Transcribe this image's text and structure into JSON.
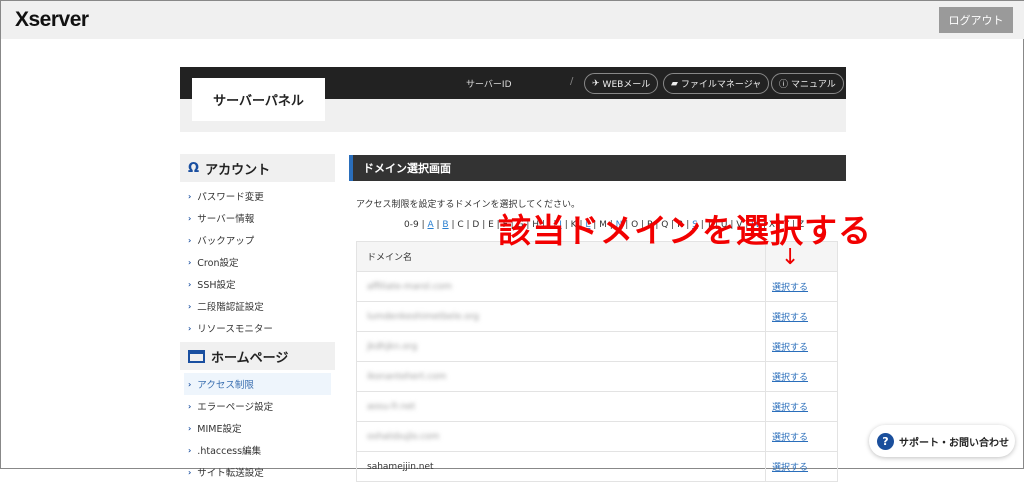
{
  "header": {
    "logo": "Xserver",
    "logout": "ログアウト"
  },
  "panel": {
    "title": "サーバーパネル",
    "server_id_label": "サーバーID",
    "separator": "/",
    "webmail": "WEBメール",
    "file_manager": "ファイルマネージャ",
    "manual": "マニュアル"
  },
  "sidebar": {
    "sections": [
      {
        "title": "アカウント",
        "icon": "user-icon",
        "items": [
          "パスワード変更",
          "サーバー情報",
          "バックアップ",
          "Cron設定",
          "SSH設定",
          "二段階認証設定",
          "リソースモニター"
        ]
      },
      {
        "title": "ホームページ",
        "icon": "window-icon",
        "items": [
          "アクセス制限",
          "エラーページ設定",
          "MIME設定",
          ".htaccess編集",
          "サイト転送設定"
        ],
        "active": "アクセス制限"
      }
    ]
  },
  "main": {
    "heading": "ドメイン選択画面",
    "description": "アクセス制限を設定するドメインを選択してください。",
    "alphabet": [
      {
        "t": "0-9",
        "link": false
      },
      {
        "t": "A",
        "link": true
      },
      {
        "t": "B",
        "link": true
      },
      {
        "t": "C",
        "link": false
      },
      {
        "t": "D",
        "link": false
      },
      {
        "t": "E",
        "link": false
      },
      {
        "t": "F",
        "link": false
      },
      {
        "t": "G",
        "link": false
      },
      {
        "t": "H",
        "link": false
      },
      {
        "t": "I",
        "link": false
      },
      {
        "t": "J",
        "link": true
      },
      {
        "t": "K",
        "link": false
      },
      {
        "t": "L",
        "link": true
      },
      {
        "t": "M",
        "link": false
      },
      {
        "t": "N",
        "link": true
      },
      {
        "t": "O",
        "link": false
      },
      {
        "t": "P",
        "link": false
      },
      {
        "t": "Q",
        "link": false
      },
      {
        "t": "R",
        "link": false
      },
      {
        "t": "S",
        "link": true
      },
      {
        "t": "T",
        "link": false
      },
      {
        "t": "U",
        "link": false
      },
      {
        "t": "V",
        "link": false
      },
      {
        "t": "W",
        "link": true
      },
      {
        "t": "X",
        "link": false
      },
      {
        "t": "Y",
        "link": false
      },
      {
        "t": "Z",
        "link": false
      }
    ],
    "table": {
      "header": "ドメイン名",
      "select_label": "選択する",
      "rows": [
        {
          "domain": "affiliate-marol.com",
          "blurred": true
        },
        {
          "domain": "lumdenkeshimetbele.org",
          "blurred": true
        },
        {
          "domain": "jkdhjkn.org",
          "blurred": true
        },
        {
          "domain": "ikonantehert.com",
          "blurred": true
        },
        {
          "domain": "aosu-fr.net",
          "blurred": true
        },
        {
          "domain": "oshalsbujlo.com",
          "blurred": true
        },
        {
          "domain": "sahamejjin.net",
          "blurred": false
        }
      ]
    }
  },
  "annotation": {
    "text": "該当ドメインを選択する",
    "arrow": "↓",
    "color": "#f20000"
  },
  "support": {
    "label": "サポート・お問い合わせ",
    "icon": "?"
  }
}
